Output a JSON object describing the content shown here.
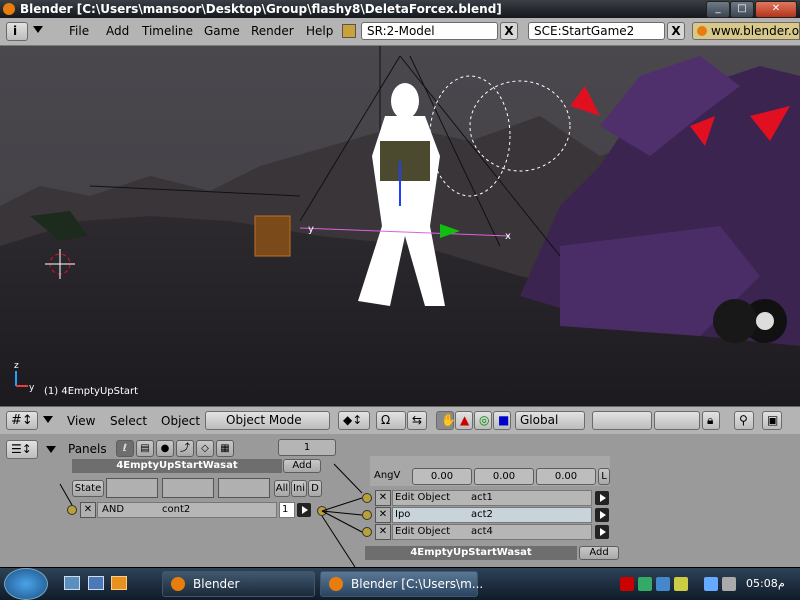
{
  "window": {
    "title": "Blender [C:\\Users\\mansoor\\Desktop\\Group\\flashy8\\DeletaForcex.blend]"
  },
  "menubar": {
    "menus": [
      "File",
      "Add",
      "Timeline",
      "Game",
      "Render",
      "Help"
    ],
    "screen_field": "SR:2-Model",
    "scene_field": "SCE:StartGame2",
    "url_field": "www.blender.org",
    "close_glyph": "X"
  },
  "viewport": {
    "object_info": "(1) 4EmptyUpStart",
    "axis_labels": {
      "x": "x",
      "y": "y",
      "z": "z"
    }
  },
  "view3d_header": {
    "view_menu": "View",
    "select_menu": "Select",
    "object_menu": "Object",
    "mode": "Object Mode",
    "orientation": "Global"
  },
  "logic_panel": {
    "panels_label": "Panels",
    "frame_value": "1",
    "object_name": "4EmptyUpStartWasat",
    "add_label": "Add",
    "state_label": "State",
    "all_label": "All",
    "ini_label": "Ini",
    "d_label": "D",
    "controller": {
      "type": "AND",
      "name": "cont2",
      "value": "1"
    },
    "angv": {
      "label": "AngV",
      "values": [
        "0.00",
        "0.00",
        "0.00"
      ],
      "flag": "L"
    },
    "actuators": [
      {
        "type": "Edit Object",
        "name": "act1"
      },
      {
        "type": "Ipo",
        "name": "act2"
      },
      {
        "type": "Edit Object",
        "name": "act4"
      }
    ],
    "second_object_name": "4EmptyUpStartWasat",
    "second_add_label": "Add"
  },
  "taskbar": {
    "tasks": [
      "Blender",
      "Blender [C:\\Users\\m..."
    ],
    "clock": "05:08",
    "clock_suffix": "م"
  },
  "colors": {
    "viewport_bg": "#3c3a3f",
    "header_bg": "#b4b4b4",
    "panel_bg": "#9a9a9a",
    "blender_orange": "#e87d0d"
  }
}
